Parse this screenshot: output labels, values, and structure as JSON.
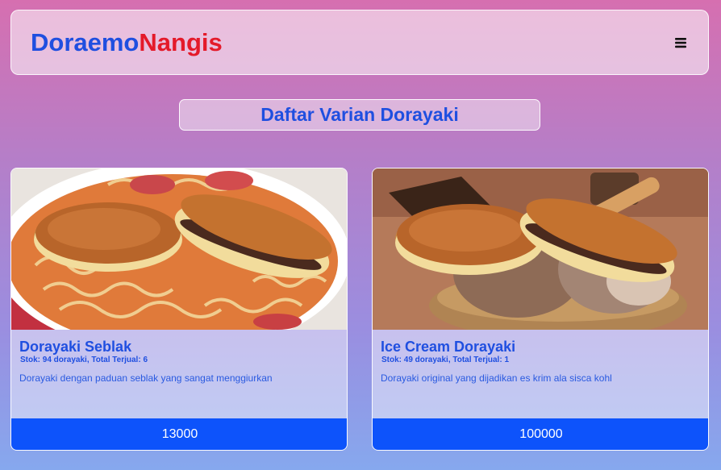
{
  "navbar": {
    "brand_part1": "Doraemo",
    "brand_part2": "Nangis",
    "menu_icon": "hamburger-menu-icon"
  },
  "page": {
    "heading": "Daftar Varian Dorayaki"
  },
  "products": [
    {
      "name": "Dorayaki Seblak",
      "stock_line": "Stok: 94 dorayaki, Total Terjual: 6",
      "description": "Dorayaki dengan paduan seblak yang sangat menggiurkan",
      "price": "13000",
      "image": "dorayaki-seblak-photo"
    },
    {
      "name": "Ice Cream Dorayaki",
      "stock_line": "Stok: 49 dorayaki, Total Terjual: 1",
      "description": "Dorayaki original yang dijadikan es krim ala sisca kohl",
      "price": "100000",
      "image": "ice-cream-dorayaki-photo"
    }
  ],
  "colors": {
    "brand_blue": "#1f4fe0",
    "brand_red": "#e41a2a",
    "price_bar": "#0d53fb"
  }
}
